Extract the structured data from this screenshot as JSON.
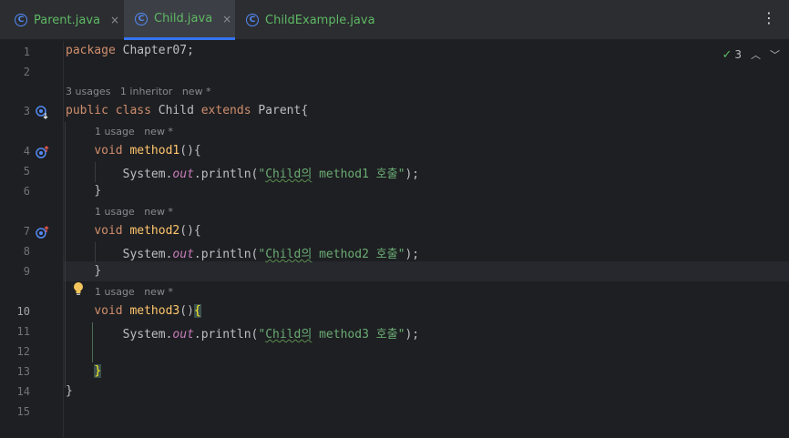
{
  "tabs": [
    {
      "label": "Parent.java",
      "close": "×",
      "icon": "C"
    },
    {
      "label": "Child.java",
      "close": "×",
      "icon": "C"
    },
    {
      "label": "ChildExample.java",
      "icon": "C"
    }
  ],
  "menu_icon": "⋮",
  "inspection": {
    "count": "3",
    "check": "✓"
  },
  "line_numbers": [
    "1",
    "2",
    "3",
    "4",
    "5",
    "6",
    "7",
    "8",
    "9",
    "10",
    "11",
    "12",
    "13",
    "14",
    "15"
  ],
  "hints": {
    "class_usages": "3 usages",
    "class_inheritor": "1 inheritor",
    "class_new": "new *",
    "m1_usage": "1 usage",
    "m1_new": "new *",
    "m2_usage": "1 usage",
    "m2_new": "new *",
    "m3_usage": "1 usage",
    "m3_new": "new *"
  },
  "code": {
    "l1_kw": "package",
    "l1_rest": " Chapter07;",
    "l3_kw1": "public",
    "l3_kw2": "class",
    "l3_name": " Child ",
    "l3_kw3": "extends",
    "l3_rest": " Parent{",
    "m_void": "void",
    "m1_name": "method1",
    "m2_name": "method2",
    "m3_name": "method3",
    "paren": "()",
    "open_brace": "{",
    "close_brace": "}",
    "sys": "System.",
    "out": "out",
    "println": ".println(",
    "str_q": "\"",
    "str_child": "Child의",
    "str1": " method1 호출\"",
    "str2": " method2 호출\"",
    "str3": " method3 호출\"",
    "end": ");"
  }
}
